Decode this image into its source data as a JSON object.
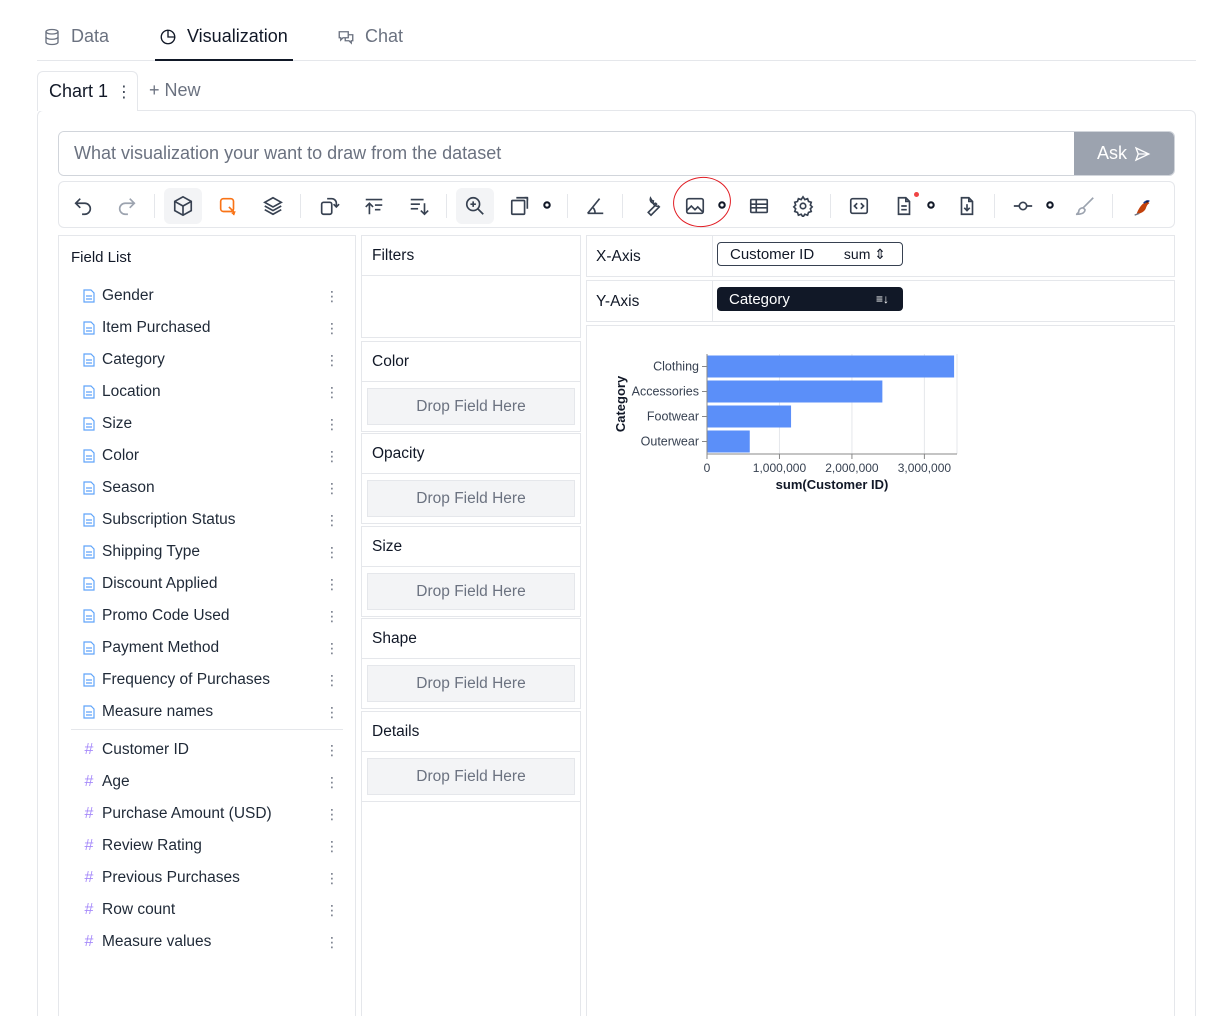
{
  "top_tabs": [
    {
      "label": "Data",
      "icon": "database-icon"
    },
    {
      "label": "Visualization",
      "icon": "chart-pie-icon",
      "active": true
    },
    {
      "label": "Chat",
      "icon": "chat-bubbles-icon"
    }
  ],
  "chart_tabs": {
    "current": "Chart 1",
    "new_label": "+ New"
  },
  "ask": {
    "placeholder": "What visualization your want to draw from the dataset",
    "button_label": "Ask"
  },
  "field_list": {
    "title": "Field List",
    "dimensions": [
      "Gender",
      "Item Purchased",
      "Category",
      "Location",
      "Size",
      "Color",
      "Season",
      "Subscription Status",
      "Shipping Type",
      "Discount Applied",
      "Promo Code Used",
      "Payment Method",
      "Frequency of Purchases",
      "Measure names"
    ],
    "measures": [
      "Customer ID",
      "Age",
      "Purchase Amount (USD)",
      "Review Rating",
      "Previous Purchases",
      "Row count",
      "Measure values"
    ]
  },
  "encodings": {
    "filters": "Filters",
    "color": "Color",
    "opacity": "Opacity",
    "size": "Size",
    "shape": "Shape",
    "details": "Details",
    "drop_hint": "Drop Field Here"
  },
  "axes": {
    "x_label": "X-Axis",
    "x_field": "Customer ID",
    "x_agg": "sum",
    "y_label": "Y-Axis",
    "y_field": "Category"
  },
  "colors": {
    "bar": "#5b8ff9",
    "annotation": "#e11d24",
    "dark_pill": "#111827"
  },
  "chart_data": {
    "type": "bar",
    "orientation": "horizontal",
    "categories": [
      "Clothing",
      "Accessories",
      "Footwear",
      "Outerwear"
    ],
    "values": [
      3410000,
      2420000,
      1160000,
      590000
    ],
    "xlabel": "sum(Customer ID)",
    "ylabel": "Category",
    "xlim": [
      0,
      3450000
    ],
    "x_ticks": [
      "0",
      "1,000,000",
      "2,000,000",
      "3,000,000"
    ],
    "grid": true
  }
}
